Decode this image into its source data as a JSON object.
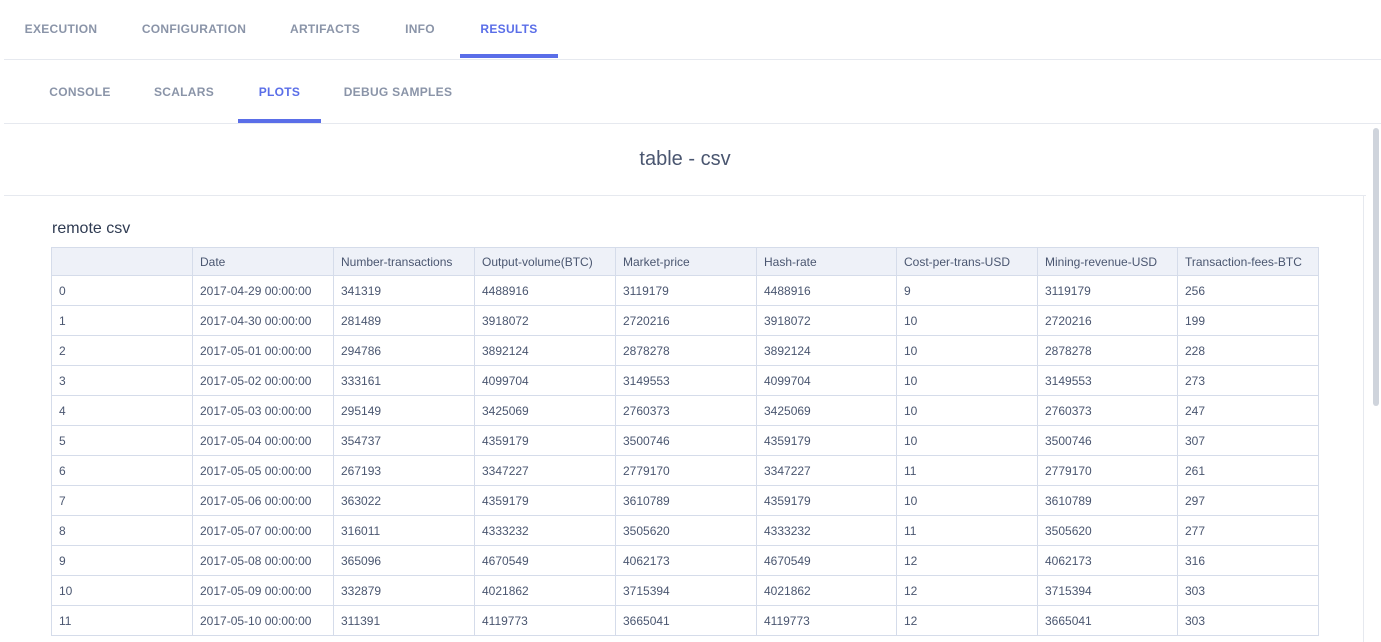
{
  "main_tabs": [
    {
      "label": "EXECUTION",
      "active": false
    },
    {
      "label": "CONFIGURATION",
      "active": false
    },
    {
      "label": "ARTIFACTS",
      "active": false
    },
    {
      "label": "INFO",
      "active": false
    },
    {
      "label": "RESULTS",
      "active": true
    }
  ],
  "sub_tabs": [
    {
      "label": "CONSOLE",
      "active": false
    },
    {
      "label": "SCALARS",
      "active": false
    },
    {
      "label": "PLOTS",
      "active": true
    },
    {
      "label": "DEBUG SAMPLES",
      "active": false
    }
  ],
  "plot": {
    "title": "table - csv",
    "table_title": "remote csv"
  },
  "table": {
    "columns": [
      "",
      "Date",
      "Number-transactions",
      "Output-volume(BTC)",
      "Market-price",
      "Hash-rate",
      "Cost-per-trans-USD",
      "Mining-revenue-USD",
      "Transaction-fees-BTC"
    ],
    "rows": [
      [
        "0",
        "2017-04-29 00:00:00",
        "341319",
        "4488916",
        "3119179",
        "4488916",
        "9",
        "3119179",
        "256"
      ],
      [
        "1",
        "2017-04-30 00:00:00",
        "281489",
        "3918072",
        "2720216",
        "3918072",
        "10",
        "2720216",
        "199"
      ],
      [
        "2",
        "2017-05-01 00:00:00",
        "294786",
        "3892124",
        "2878278",
        "3892124",
        "10",
        "2878278",
        "228"
      ],
      [
        "3",
        "2017-05-02 00:00:00",
        "333161",
        "4099704",
        "3149553",
        "4099704",
        "10",
        "3149553",
        "273"
      ],
      [
        "4",
        "2017-05-03 00:00:00",
        "295149",
        "3425069",
        "2760373",
        "3425069",
        "10",
        "2760373",
        "247"
      ],
      [
        "5",
        "2017-05-04 00:00:00",
        "354737",
        "4359179",
        "3500746",
        "4359179",
        "10",
        "3500746",
        "307"
      ],
      [
        "6",
        "2017-05-05 00:00:00",
        "267193",
        "3347227",
        "2779170",
        "3347227",
        "11",
        "2779170",
        "261"
      ],
      [
        "7",
        "2017-05-06 00:00:00",
        "363022",
        "4359179",
        "3610789",
        "4359179",
        "10",
        "3610789",
        "297"
      ],
      [
        "8",
        "2017-05-07 00:00:00",
        "316011",
        "4333232",
        "3505620",
        "4333232",
        "11",
        "3505620",
        "277"
      ],
      [
        "9",
        "2017-05-08 00:00:00",
        "365096",
        "4670549",
        "4062173",
        "4670549",
        "12",
        "4062173",
        "316"
      ],
      [
        "10",
        "2017-05-09 00:00:00",
        "332879",
        "4021862",
        "3715394",
        "4021862",
        "12",
        "3715394",
        "303"
      ],
      [
        "11",
        "2017-05-10 00:00:00",
        "311391",
        "4119773",
        "3665041",
        "4119773",
        "12",
        "3665041",
        "303"
      ]
    ]
  },
  "colors": {
    "accent": "#5a6ee8",
    "tab_inactive": "#8a94a8",
    "header_bg": "#eef1f8",
    "border": "#d5dcea"
  }
}
